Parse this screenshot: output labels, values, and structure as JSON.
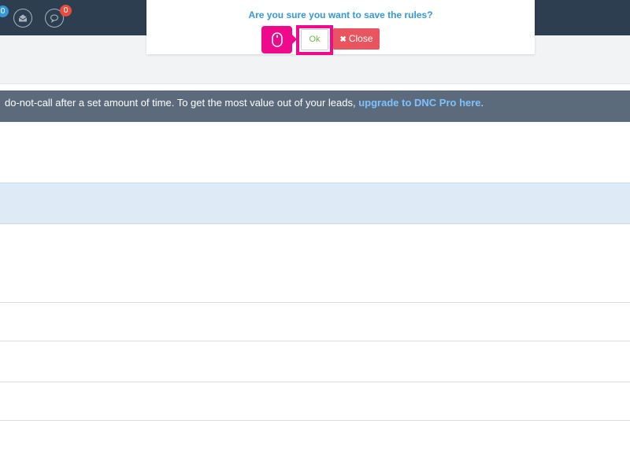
{
  "topbar": {
    "notifications_badge": "0",
    "messages_badge": "0",
    "icons": [
      "globe-icon",
      "envelope-icon",
      "chat-bubble-icon"
    ],
    "colors": {
      "background": "#2c3e50",
      "badge_blue": "#3498db",
      "badge_red": "#e74c3c"
    }
  },
  "notice": {
    "text": "do-not-call after a set amount of time. To get the most value out of your leads, ",
    "link_text": "upgrade to DNC Pro here",
    "suffix": "."
  },
  "modal": {
    "title": "Are you sure you want to save the rules?",
    "ok_label": "Ok",
    "close_label": "Close",
    "close_icon": "times-icon",
    "colors": {
      "title": "#3498db",
      "ok_text": "#6bb844",
      "close_bg": "#e9555f",
      "highlight": "#ee0a8a"
    }
  },
  "cursor": {
    "icon": "mouse-icon"
  }
}
